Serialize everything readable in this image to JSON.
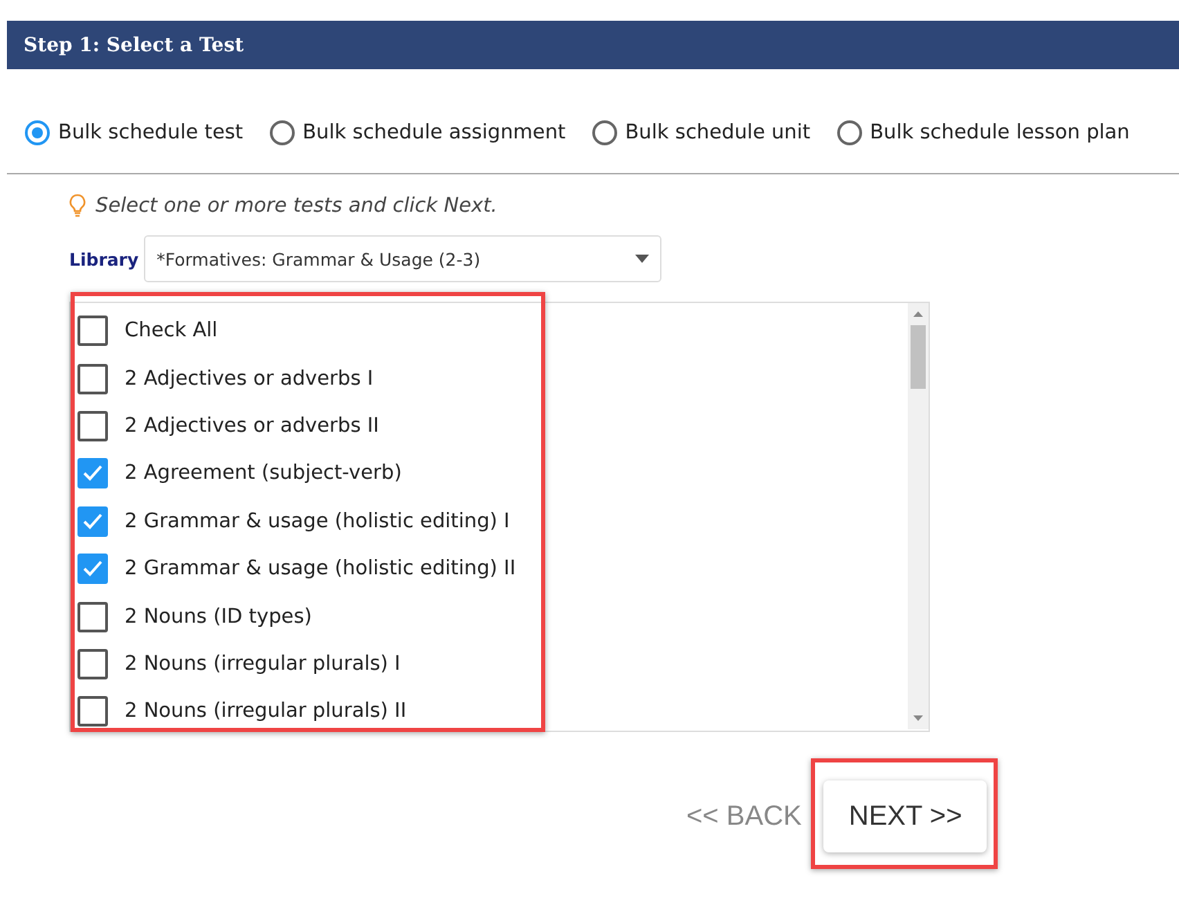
{
  "header": {
    "title": "Step 1: Select a Test"
  },
  "modes": [
    {
      "label": "Bulk schedule test",
      "selected": true
    },
    {
      "label": "Bulk schedule assignment",
      "selected": false
    },
    {
      "label": "Bulk schedule unit",
      "selected": false
    },
    {
      "label": "Bulk schedule lesson plan",
      "selected": false
    }
  ],
  "hint": "Select one or more tests and click Next.",
  "library": {
    "label": "Library",
    "value": "*Formatives: Grammar & Usage (2-3)"
  },
  "tests": [
    {
      "label": "Check All",
      "checked": false
    },
    {
      "label": "2 Adjectives or adverbs I",
      "checked": false
    },
    {
      "label": "2 Adjectives or adverbs II",
      "checked": false
    },
    {
      "label": "2 Agreement (subject-verb)",
      "checked": true
    },
    {
      "label": "2 Grammar & usage (holistic editing) I",
      "checked": true
    },
    {
      "label": "2 Grammar & usage (holistic editing) II",
      "checked": true
    },
    {
      "label": "2 Nouns (ID types)",
      "checked": false
    },
    {
      "label": "2 Nouns (irregular plurals) I",
      "checked": false
    },
    {
      "label": "2 Nouns (irregular plurals) II",
      "checked": false
    }
  ],
  "buttons": [
    {
      "label": "<< BACK",
      "disabled": true
    },
    {
      "label": "NEXT >>",
      "disabled": false
    }
  ]
}
